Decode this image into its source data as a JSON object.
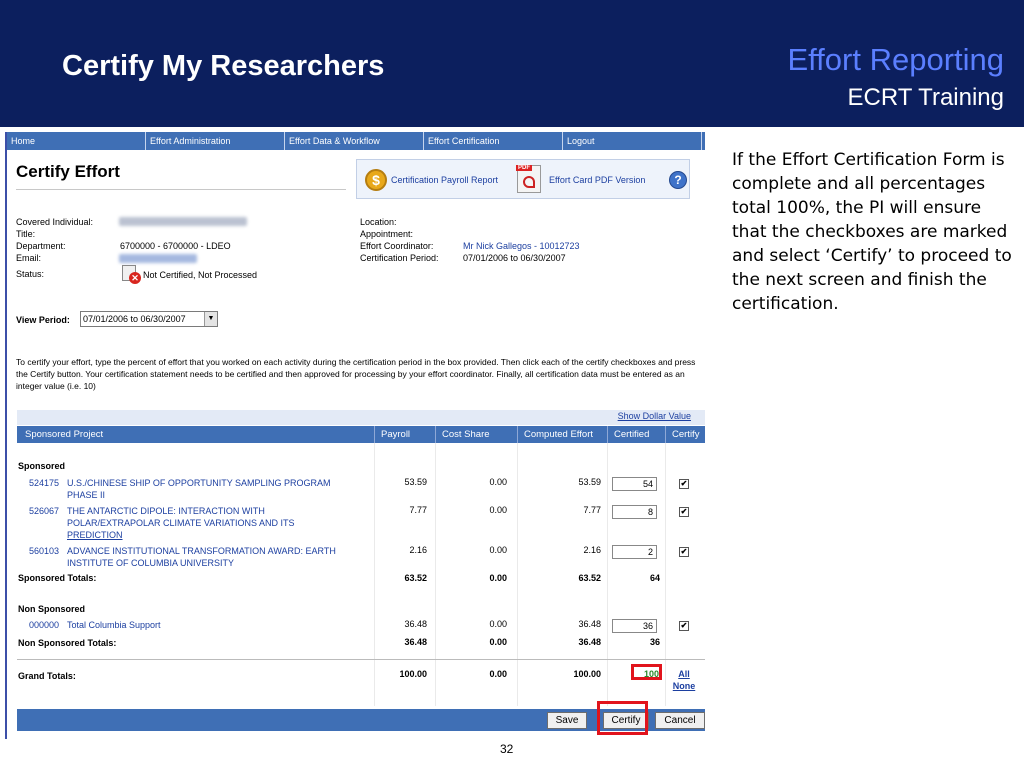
{
  "header": {
    "title": "Certify My Researchers",
    "brand": "Effort Reporting",
    "subbrand": "ECRT Training"
  },
  "nav": [
    "Home",
    "Effort Administration",
    "Effort Data & Workflow",
    "Effort Certification",
    "Logout"
  ],
  "page": {
    "title": "Certify Effort",
    "links": {
      "payroll": "Certification Payroll Report",
      "pdf": "Effort Card PDF Version"
    }
  },
  "info": {
    "covered_label": "Covered Individual:",
    "title_label": "Title:",
    "department_label": "Department:",
    "department_value": "6700000 - 6700000 - LDEO",
    "email_label": "Email:",
    "status_label": "Status:",
    "status_value": "Not Certified, Not Processed",
    "location_label": "Location:",
    "appointment_label": "Appointment:",
    "coordinator_label": "Effort Coordinator:",
    "coordinator_value": "Mr Nick Gallegos - 10012723",
    "period_label": "Certification Period:",
    "period_value": "07/01/2006 to 06/30/2007"
  },
  "view_period": {
    "label": "View Period:",
    "value": "07/01/2006 to 06/30/2007"
  },
  "instructions": "To certify your effort, type the percent of effort that you worked on each activity during the certification period in the box provided. Then click each of the certify checkboxes and press the Certify button. Your certification statement needs to be certified and then approved for processing by your effort coordinator. Finally, all certification data must be entered as an integer value (i.e. 10)",
  "show_dollar": "Show Dollar Value",
  "table": {
    "columns": [
      "Sponsored Project",
      "Payroll",
      "Cost Share",
      "Computed Effort",
      "Certified",
      "Certify"
    ],
    "sponsored_heading": "Sponsored",
    "sponsored_rows": [
      {
        "id": "524175",
        "line1": "U.S./CHINESE SHIP OF OPPORTUNITY SAMPLING PROGRAM",
        "line2": "PHASE II",
        "line3": "",
        "payroll": "53.59",
        "cost_share": "0.00",
        "computed": "53.59",
        "certified": "54",
        "checked": "✔"
      },
      {
        "id": "526067",
        "line1": "THE ANTARCTIC DIPOLE: INTERACTION WITH",
        "line2": "POLAR/EXTRAPOLAR CLIMATE VARIATIONS AND ITS",
        "line3": "PREDICTION",
        "payroll": "7.77",
        "cost_share": "0.00",
        "computed": "7.77",
        "certified": "8",
        "checked": "✔"
      },
      {
        "id": "560103",
        "line1": "ADVANCE INSTITUTIONAL TRANSFORMATION AWARD: EARTH",
        "line2": "INSTITUTE OF COLUMBIA UNIVERSITY",
        "line3": "",
        "payroll": "2.16",
        "cost_share": "0.00",
        "computed": "2.16",
        "certified": "2",
        "checked": "✔"
      }
    ],
    "sponsored_totals": {
      "label": "Sponsored Totals:",
      "payroll": "63.52",
      "cost_share": "0.00",
      "computed": "63.52",
      "certified": "64"
    },
    "nonsponsored_heading": "Non Sponsored",
    "nonsponsored_rows": [
      {
        "id": "000000",
        "line1": "Total Columbia Support",
        "payroll": "36.48",
        "cost_share": "0.00",
        "computed": "36.48",
        "certified": "36",
        "checked": "✔"
      }
    ],
    "nonsponsored_totals": {
      "label": "Non Sponsored Totals:",
      "payroll": "36.48",
      "cost_share": "0.00",
      "computed": "36.48",
      "certified": "36"
    },
    "grand_totals": {
      "label": "Grand Totals:",
      "payroll": "100.00",
      "cost_share": "0.00",
      "computed": "100.00",
      "certified": "100"
    },
    "all_label": "All",
    "none_label": "None"
  },
  "buttons": {
    "save": "Save",
    "certify": "Certify",
    "cancel": "Cancel"
  },
  "explanation": "If the Effort Certification Form is complete and all percentages total 100%, the PI will ensure that the checkboxes are marked and  select ‘Certify’ to proceed to the next screen and finish the certification.",
  "page_number": "32",
  "colors": {
    "header_bg": "#0c1f5e",
    "brand": "#5b7fff",
    "table_header": "#3f6fb5",
    "highlight": "#e1141c",
    "link": "#1c3fa0"
  }
}
